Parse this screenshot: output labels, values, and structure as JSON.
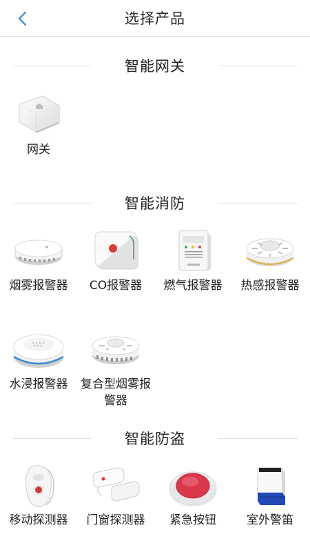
{
  "header": {
    "title": "选择产品"
  },
  "sections": [
    {
      "title": "智能网关",
      "items": [
        {
          "label": "网关",
          "icon": "gateway-icon"
        }
      ]
    },
    {
      "title": "智能消防",
      "items": [
        {
          "label": "烟雾报警器",
          "icon": "smoke-alarm-icon"
        },
        {
          "label": "CO报警器",
          "icon": "co-alarm-icon"
        },
        {
          "label": "燃气报警器",
          "icon": "gas-alarm-icon"
        },
        {
          "label": "热感报警器",
          "icon": "heat-alarm-icon"
        },
        {
          "label": "水浸报警器",
          "icon": "water-leak-icon"
        },
        {
          "label": "复合型烟雾报警器",
          "icon": "composite-smoke-alarm-icon"
        }
      ]
    },
    {
      "title": "智能防盗",
      "items": [
        {
          "label": "移动探测器",
          "icon": "motion-detector-icon"
        },
        {
          "label": "门窗探测器",
          "icon": "door-window-sensor-icon"
        },
        {
          "label": "紧急按钮",
          "icon": "emergency-button-icon"
        },
        {
          "label": "室外警笛",
          "icon": "outdoor-siren-icon"
        }
      ]
    }
  ],
  "colors": {
    "accent": "#3a86d6",
    "emergency_red": "#d9374a"
  }
}
